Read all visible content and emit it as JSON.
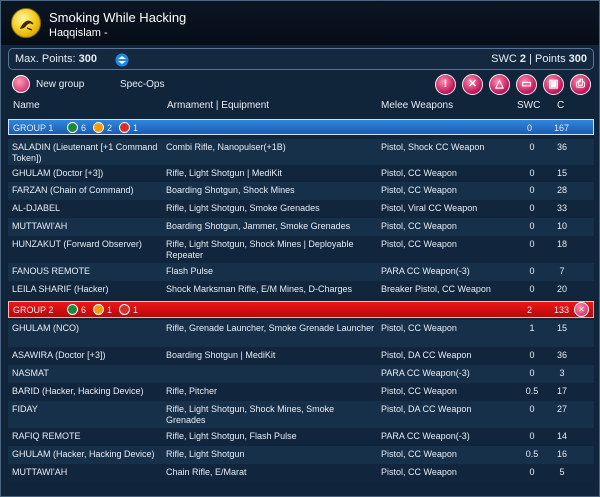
{
  "header": {
    "title": "Smoking While Hacking",
    "subtitle": "Haqqislam -"
  },
  "points": {
    "max_label": "Max. Points:",
    "max_value": "300",
    "swc_label": "SWC",
    "swc_value": "2",
    "pts_label": "| Points",
    "pts_value": "300"
  },
  "toolbar": {
    "new_group": "New group",
    "spec_ops": "Spec-Ops"
  },
  "columns": {
    "name": "Name",
    "armament": "Armament | Equipment",
    "melee": "Melee Weapons",
    "swc": "SWC",
    "c": "C"
  },
  "groups": [
    {
      "label": "GROUP 1",
      "green": "6",
      "orange": "2",
      "red": "1",
      "swc": "0",
      "c": "167"
    },
    {
      "label": "GROUP 2",
      "green": "6",
      "orange": "1",
      "red": "1",
      "swc": "2",
      "c": "133"
    }
  ],
  "rows": [
    {
      "name": "SALADIN (Lieutenant [+1 Command Token])",
      "arm": "Combi Rifle, Nanopulser(+1B)",
      "melee": "Pistol, Shock CC Weapon",
      "swc": "0",
      "c": "36"
    },
    {
      "name": "GHULAM (Doctor [+3])",
      "arm": "Rifle, Light Shotgun | MediKit",
      "melee": "Pistol, CC Weapon",
      "swc": "0",
      "c": "15"
    },
    {
      "name": "FARZAN (Chain of Command)",
      "arm": "Boarding Shotgun, Shock Mines",
      "melee": "Pistol, CC Weapon",
      "swc": "0",
      "c": "28"
    },
    {
      "name": "AL-DJABEL",
      "arm": "Rifle, Light Shotgun, Smoke Grenades",
      "melee": "Pistol, Viral CC Weapon",
      "swc": "0",
      "c": "33"
    },
    {
      "name": "MUTTAWI'AH",
      "arm": "Boarding Shotgun, Jammer, Smoke Grenades",
      "melee": "Pistol, CC Weapon",
      "swc": "0",
      "c": "10"
    },
    {
      "name": "HUNZAKUT (Forward Observer)",
      "arm": "Rifle, Light Shotgun, Shock Mines | Deployable Repeater",
      "melee": "Pistol, CC Weapon",
      "swc": "0",
      "c": "18"
    },
    {
      "name": "FANOUS REMOTE",
      "arm": "Flash Pulse",
      "melee": "PARA CC Weapon(-3)",
      "swc": "0",
      "c": "7"
    },
    {
      "name": "LEILA SHARIF (Hacker)",
      "arm": "Shock Marksman Rifle, E/M Mines, D-Charges",
      "melee": "Breaker Pistol, CC Weapon",
      "swc": "0",
      "c": "20"
    },
    {
      "name": "GHULAM (NCO)",
      "arm": "Rifle, Grenade Launcher, Smoke Grenade Launcher",
      "melee": "Pistol, CC Weapon",
      "swc": "1",
      "c": "15"
    },
    {
      "name": "ASAWIRA (Doctor [+3])",
      "arm": "Boarding Shotgun | MediKit",
      "melee": "Pistol, DA CC Weapon",
      "swc": "0",
      "c": "36"
    },
    {
      "name": "NASMAT",
      "arm": "",
      "melee": "PARA CC Weapon(-3)",
      "swc": "0",
      "c": "3"
    },
    {
      "name": "BARID (Hacker, Hacking Device)",
      "arm": "Rifle, Pitcher",
      "melee": "Pistol, CC Weapon",
      "swc": "0.5",
      "c": "17"
    },
    {
      "name": "FIDAY",
      "arm": "Rifle, Light Shotgun, Shock Mines, Smoke Grenades",
      "melee": "Pistol, DA CC Weapon",
      "swc": "0",
      "c": "27"
    },
    {
      "name": "RAFIQ REMOTE",
      "arm": "Rifle, Light Shotgun, Flash Pulse",
      "melee": "PARA CC Weapon(-3)",
      "swc": "0",
      "c": "14"
    },
    {
      "name": "GHULAM (Hacker, Hacking Device)",
      "arm": "Rifle, Light Shotgun",
      "melee": "Pistol, CC Weapon",
      "swc": "0.5",
      "c": "16"
    },
    {
      "name": "MUTTAWI'AH",
      "arm": "Chain Rifle, E/Marat",
      "melee": "Pistol, CC Weapon",
      "swc": "0",
      "c": "5"
    }
  ],
  "colors": {
    "group1": "#1f6fc9",
    "group2": "#e31010",
    "accent": "#c2185b"
  }
}
